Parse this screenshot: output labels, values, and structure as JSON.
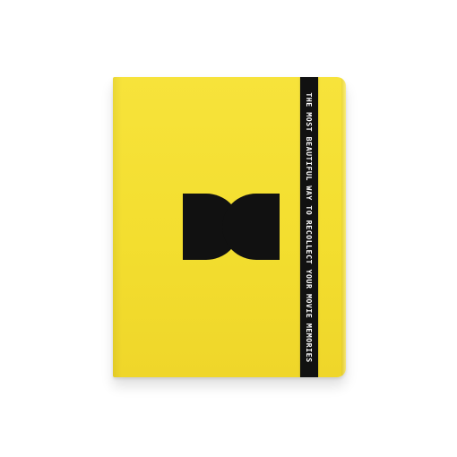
{
  "image": {
    "background_color": "#ffffff"
  },
  "notebook": {
    "cover_color": "#f3de2f",
    "strap_color": "#111111",
    "logo_color": "#111111",
    "strap_text": "THE MOST BEAUTIFUL WAY TO RECOLLECT YOUR MOVIE MEMORIES"
  }
}
